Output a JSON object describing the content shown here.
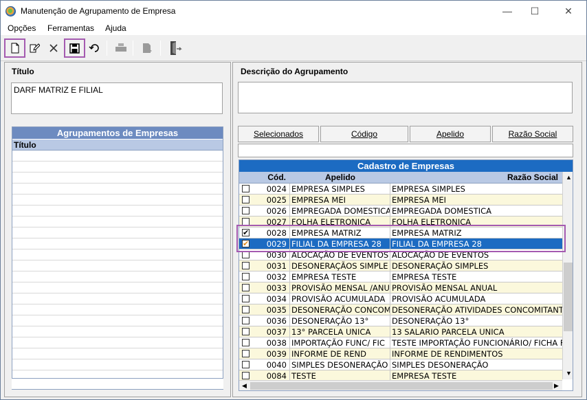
{
  "window": {
    "title": "Manutenção de Agrupamento de Empresa",
    "minimize": "—",
    "maximize": "☐",
    "close": "✕"
  },
  "menu": [
    "Opções",
    "Ferramentas",
    "Ajuda"
  ],
  "toolbar": {
    "icons": [
      "new-document-icon",
      "edit-icon",
      "delete-icon",
      "save-icon",
      "undo-icon",
      "print-icon",
      "report-icon",
      "exit-door-icon"
    ],
    "highlight_color": "#a45ab0"
  },
  "left": {
    "title_label": "Título",
    "title_value": "DARF MATRIZ E FILIAL",
    "grid_caption": "Agrupamentos de Empresas",
    "grid_col": "Título"
  },
  "right": {
    "desc_label": "Descrição do Agrupamento",
    "desc_value": "",
    "tabs": [
      "Selecionados",
      "Código",
      "Apelido",
      "Razão Social"
    ],
    "grid_caption": "Cadastro de Empresas",
    "cols": [
      "Cód.",
      "Apelido",
      "Razão Social"
    ],
    "rows": [
      {
        "checked": false,
        "cod": "0024",
        "apelido": "EMPRESA SIMPLES",
        "razao": "EMPRESA SIMPLES"
      },
      {
        "checked": false,
        "cod": "0025",
        "apelido": "EMPRESA MEI",
        "razao": "EMPRESA MEI"
      },
      {
        "checked": false,
        "cod": "0026",
        "apelido": "EMPREGADA DOMESTICA",
        "razao": "EMPREGADA DOMESTICA"
      },
      {
        "checked": false,
        "cod": "0027",
        "apelido": "FOLHA ELETRONICA",
        "razao": "FOLHA ELETRONICA"
      },
      {
        "checked": true,
        "cod": "0028",
        "apelido": "EMPRESA MATRIZ",
        "razao": "EMPRESA MATRIZ"
      },
      {
        "checked": true,
        "cod": "0029",
        "apelido": "FILIAL DA EMPRESA 28",
        "razao": "FILIAL DA EMPRESA 28",
        "selected": true
      },
      {
        "checked": false,
        "cod": "0030",
        "apelido": "ALOCAÇÃO DE EVENTOS",
        "razao": "ALOCAÇÃO DE EVENTOS"
      },
      {
        "checked": false,
        "cod": "0031",
        "apelido": "DESONERAÇÃOS SIMPLE",
        "razao": "DESONERAÇÃO SIMPLES"
      },
      {
        "checked": false,
        "cod": "0032",
        "apelido": "EMPRESA TESTE",
        "razao": "EMPRESA TESTE"
      },
      {
        "checked": false,
        "cod": "0033",
        "apelido": "PROVISÃO MENSAL /ANU",
        "razao": "PROVISÃO MENSAL ANUAL"
      },
      {
        "checked": false,
        "cod": "0034",
        "apelido": "PROVISÃO ACUMULADA",
        "razao": "PROVISÃO ACUMULADA"
      },
      {
        "checked": false,
        "cod": "0035",
        "apelido": "DESONERAÇÃO CONCOM",
        "razao": "DESONERAÇÃO ATIVIDADES CONCOMITANTES"
      },
      {
        "checked": false,
        "cod": "0036",
        "apelido": "DESONERAÇÃO 13°",
        "razao": "DESONERAÇÃO 13°"
      },
      {
        "checked": false,
        "cod": "0037",
        "apelido": "13° PARCELA UNICA",
        "razao": "13 SALARIO PARCELA UNICA"
      },
      {
        "checked": false,
        "cod": "0038",
        "apelido": "IMPORTAÇÃO FUNC/ FIC",
        "razao": "TESTE IMPORTAÇÃO FUNCIONÁRIO/ FICHA FINANCEIRA"
      },
      {
        "checked": false,
        "cod": "0039",
        "apelido": "INFORME DE REND",
        "razao": "INFORME DE RENDIMENTOS"
      },
      {
        "checked": false,
        "cod": "0040",
        "apelido": "SIMPLES DESONERAÇÃO",
        "razao": "SIMPLES DESONERAÇÃO"
      },
      {
        "checked": false,
        "cod": "0084",
        "apelido": "TESTE",
        "razao": "EMPRESA TESTE"
      }
    ]
  }
}
